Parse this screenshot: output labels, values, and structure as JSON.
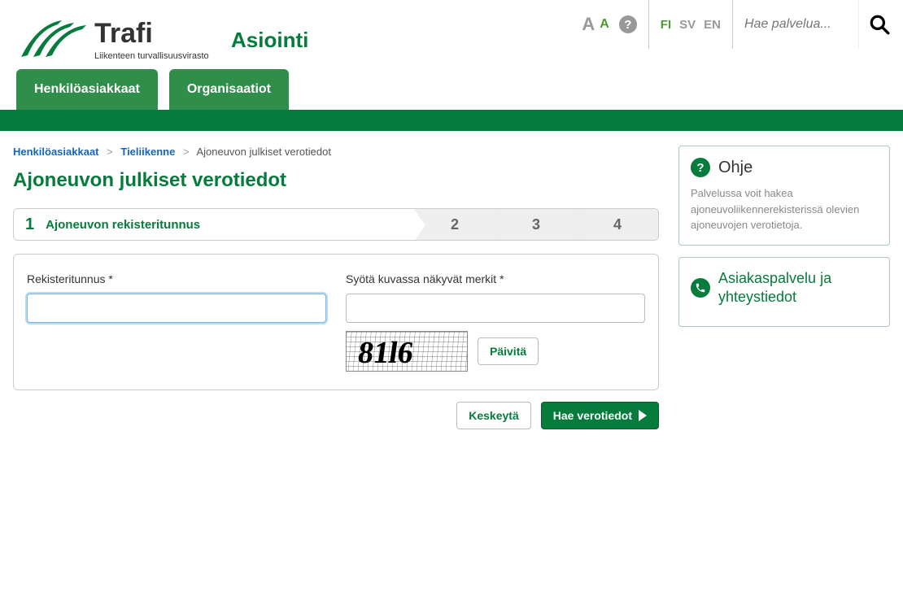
{
  "header": {
    "app_title": "Asiointi",
    "logo_sub": "Liikenteen turvallisuusvirasto",
    "logo_name": "Trafi",
    "search_placeholder": "Hae palvelua...",
    "languages": [
      "FI",
      "SV",
      "EN"
    ],
    "active_language": "FI"
  },
  "nav": {
    "tabs": [
      "Henkilöasiakkaat",
      "Organisaatiot"
    ]
  },
  "breadcrumb": {
    "items": [
      {
        "label": "Henkilöasiakkaat",
        "link": true
      },
      {
        "label": "Tieliikenne",
        "link": true
      },
      {
        "label": "Ajoneuvon julkiset verotiedot",
        "link": false
      }
    ]
  },
  "page_title": "Ajoneuvon julkiset verotiedot",
  "steps": {
    "active_label": "Ajoneuvon rekisteritunnus",
    "numbers": [
      "1",
      "2",
      "3",
      "4"
    ]
  },
  "form": {
    "reg_label": "Rekisteritunnus *",
    "captcha_label": "Syötä kuvassa näkyvät merkit *",
    "refresh_btn": "Päivitä",
    "cancel_btn": "Keskeytä",
    "submit_btn": "Hae verotiedot",
    "captcha_text": "81l6"
  },
  "sidebar": {
    "help_title": "Ohje",
    "help_text": "Palvelussa voit hakea ajoneuvoliikennerekisterissä olevien ajoneuvojen verotietoja.",
    "contact_title": "Asiakaspalvelu ja yhteystiedot"
  }
}
